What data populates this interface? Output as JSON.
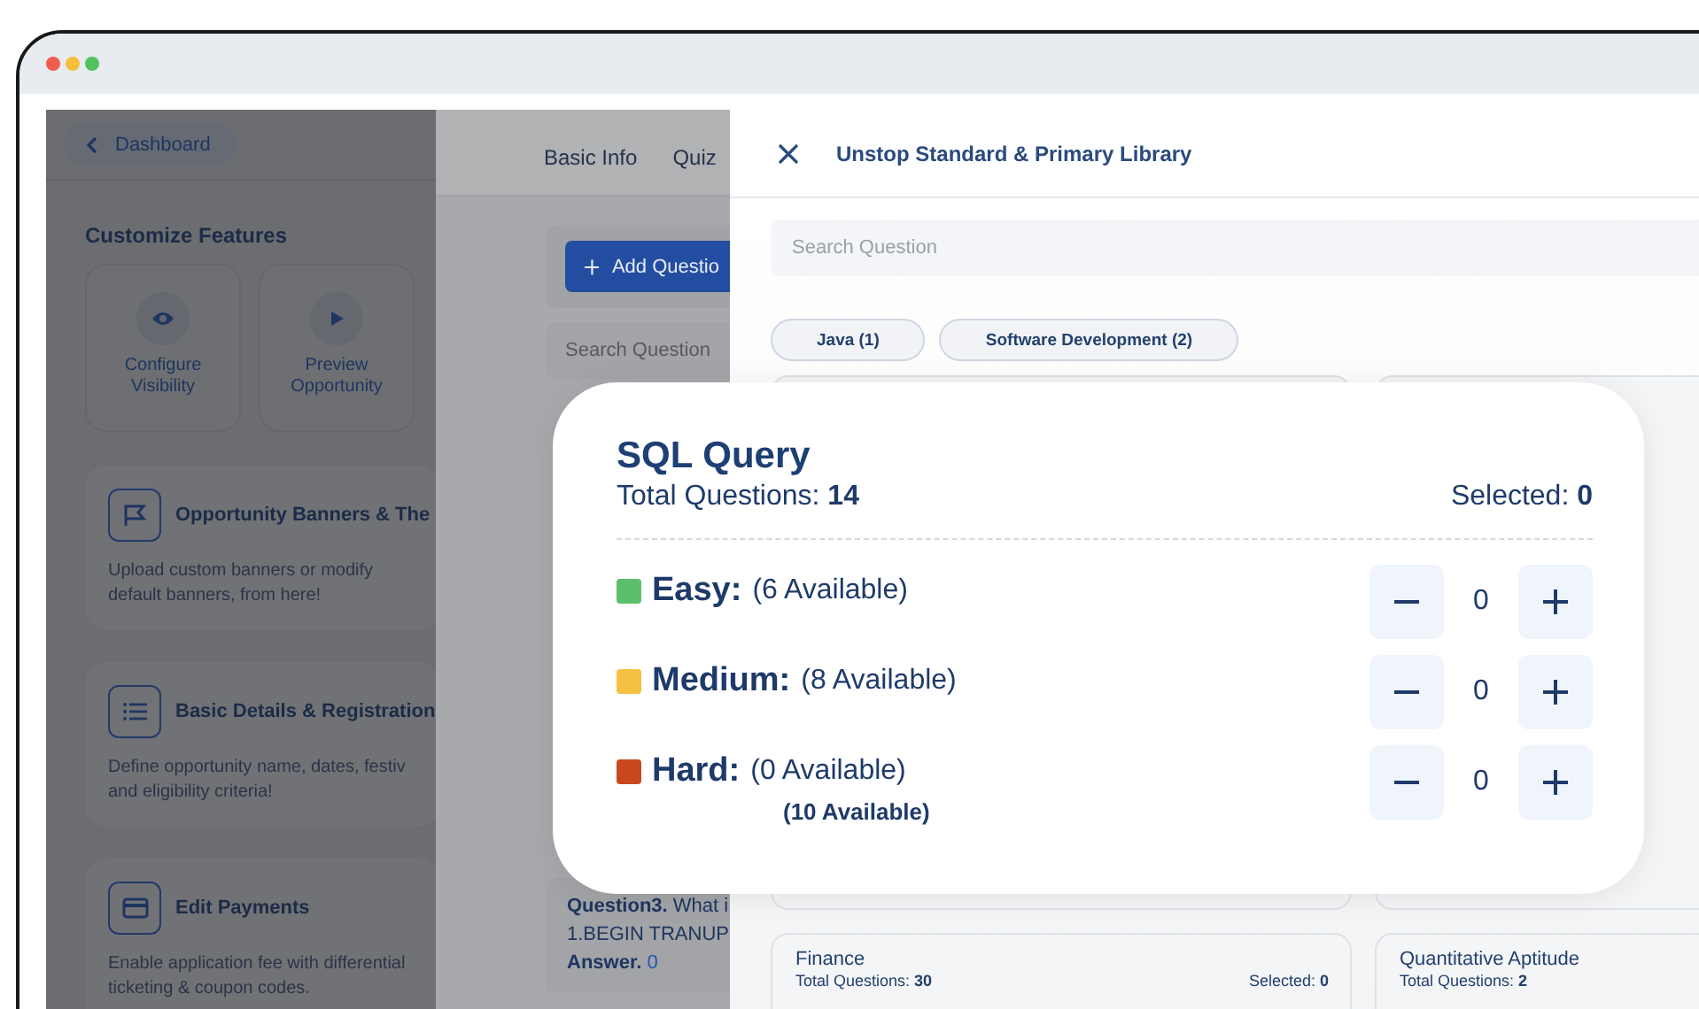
{
  "sidebar": {
    "back_button": "Dashboard",
    "section_title": "Customize Features",
    "quick_actions": [
      {
        "kind": "eye",
        "label": "Configure Visibility"
      },
      {
        "kind": "play",
        "label": "Preview Opportunity"
      }
    ],
    "feature_cards": [
      {
        "kind": "flag",
        "title": "Opportunity Banners & The",
        "lines": [
          "Upload custom banners or modify",
          "default banners, from here!"
        ]
      },
      {
        "kind": "list",
        "title": "Basic Details & Registration",
        "lines": [
          "Define opportunity name, dates, festiv",
          "and eligibility criteria!"
        ]
      },
      {
        "kind": "card",
        "title": "Edit Payments",
        "lines": [
          "Enable application fee with differential",
          "ticketing & coupon codes."
        ]
      }
    ]
  },
  "editor": {
    "tabs": [
      "Basic Info",
      "Quiz"
    ],
    "add_button": "Add Questio",
    "search": {
      "placeholder": "Search Question"
    },
    "question": {
      "title": "**Question3.** What i",
      "line": "1.BEGIN TRANUP",
      "answer_label": "Answer.",
      "answer": "0"
    }
  },
  "library": {
    "title": "Unstop Standard & Primary Library",
    "search": {
      "placeholder": "Search Question"
    },
    "filters": [
      "Java (1)",
      "Software Development (2)"
    ],
    "cards": [
      {
        "title": "Finance",
        "total": "Total Questions: **30**",
        "selected": "Selected: **0**"
      },
      {
        "title": "Quantitative Aptitude",
        "total": "Total Questions: **2**"
      }
    ]
  },
  "popup": {
    "title": "SQL Query",
    "total": "Total Questions: **14**",
    "selected": "Selected: **0**",
    "levels": [
      {
        "name": "Easy:",
        "available": "(6 Available)",
        "color": "#5cbf6b",
        "count": "0"
      },
      {
        "name": "Medium:",
        "available": "(8 Available)",
        "color": "#f5c043",
        "count": "0"
      },
      {
        "name": "Hard:",
        "available": "(0 Available)",
        "note": "(10 Available)",
        "color": "#c9471f",
        "count": "0"
      }
    ]
  }
}
